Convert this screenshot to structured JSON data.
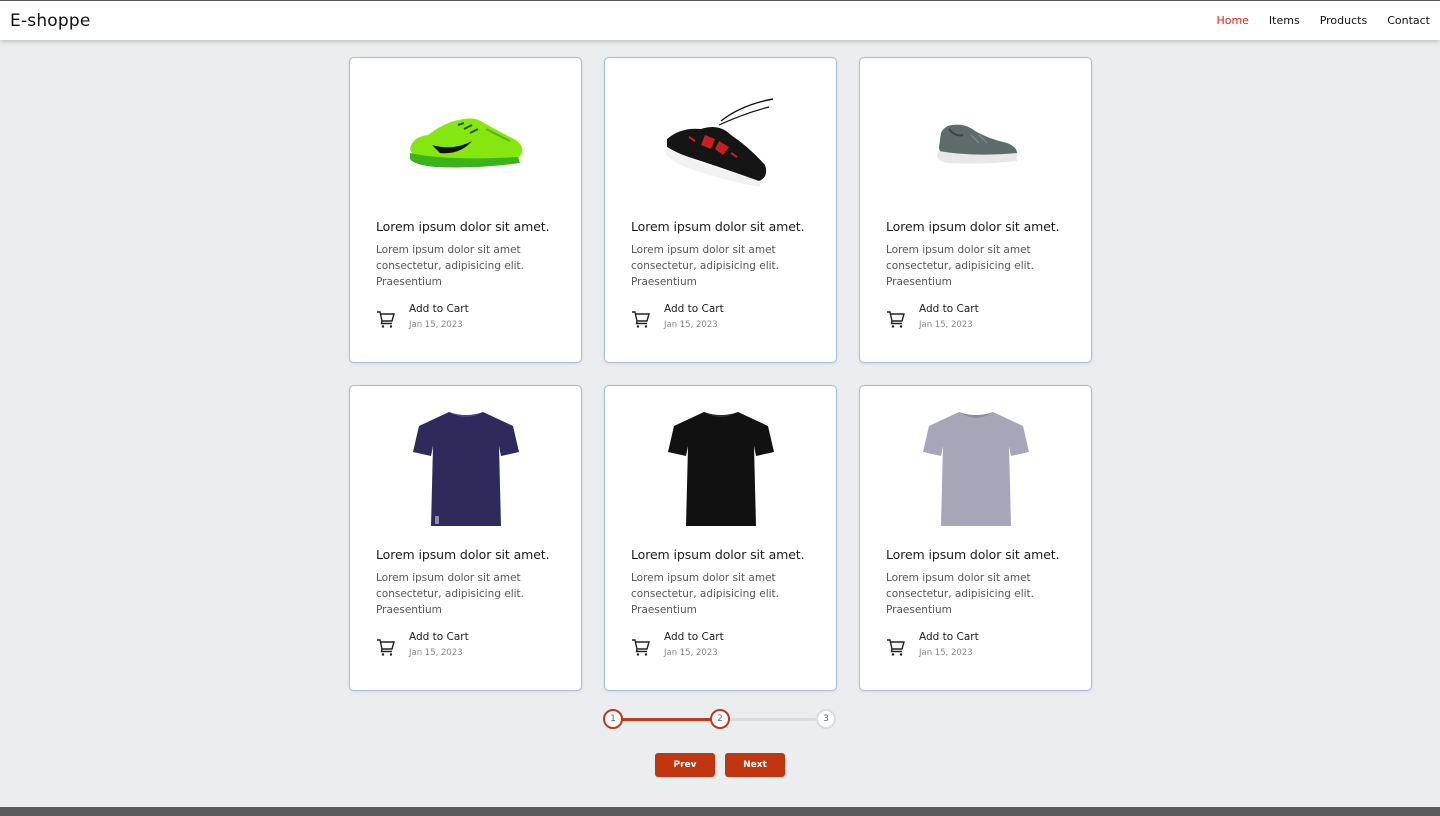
{
  "header": {
    "brand": "E-shoppe",
    "nav": [
      {
        "label": "Home",
        "active": true
      },
      {
        "label": "Items",
        "active": false
      },
      {
        "label": "Products",
        "active": false
      },
      {
        "label": "Contact",
        "active": false
      }
    ]
  },
  "products": [
    {
      "image": "green-sneaker",
      "title": "Lorem ipsum dolor sit amet.",
      "description": "Lorem ipsum dolor sit amet consectetur, adipisicing elit. Praesentium",
      "cart_label": "Add to Cart",
      "date": "Jan 15, 2023"
    },
    {
      "image": "black-red-sneaker",
      "title": "Lorem ipsum dolor sit amet.",
      "description": "Lorem ipsum dolor sit amet consectetur, adipisicing elit. Praesentium",
      "cart_label": "Add to Cart",
      "date": "Jan 15, 2023"
    },
    {
      "image": "grey-sneaker",
      "title": "Lorem ipsum dolor sit amet.",
      "description": "Lorem ipsum dolor sit amet consectetur, adipisicing elit. Praesentium",
      "cart_label": "Add to Cart",
      "date": "Jan 15, 2023"
    },
    {
      "image": "navy-tshirt",
      "title": "Lorem ipsum dolor sit amet.",
      "description": "Lorem ipsum dolor sit amet consectetur, adipisicing elit. Praesentium",
      "cart_label": "Add to Cart",
      "date": "Jan 15, 2023"
    },
    {
      "image": "black-tshirt",
      "title": "Lorem ipsum dolor sit amet.",
      "description": "Lorem ipsum dolor sit amet consectetur, adipisicing elit. Praesentium",
      "cart_label": "Add to Cart",
      "date": "Jan 15, 2023"
    },
    {
      "image": "grey-tshirt",
      "title": "Lorem ipsum dolor sit amet.",
      "description": "Lorem ipsum dolor sit amet consectetur, adipisicing elit. Praesentium",
      "cart_label": "Add to Cart",
      "date": "Jan 15, 2023"
    }
  ],
  "pagination": {
    "steps": [
      "1",
      "2",
      "3"
    ],
    "current": 2,
    "prev_label": "Prev",
    "next_label": "Next"
  },
  "colors": {
    "accent": "#c0360e",
    "nav_active": "#e0211c",
    "card_border": "#a9bcdc",
    "background": "#ecedee"
  }
}
